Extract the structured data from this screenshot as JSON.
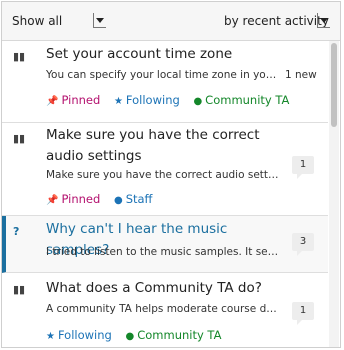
{
  "toolbar": {
    "filter_value": "Show all",
    "sort_value": "by recent activity"
  },
  "threads": [
    {
      "title": "Set your account time zone",
      "preview": "You can specify your local time zone in your account settings",
      "new_count": "1 new",
      "tags": {
        "pinned": "Pinned",
        "following": "Following",
        "community": "Community TA"
      }
    },
    {
      "title": "Make sure you have the correct audio settings",
      "preview": "Make sure you have the correct audio settings on your device",
      "count": "1",
      "tags": {
        "pinned": "Pinned",
        "staff": "Staff"
      }
    },
    {
      "title": "Why can't I hear the music samples?",
      "preview": "I tried to listen to the music samples. It seems like nothing plays",
      "count": "3"
    },
    {
      "title": "What does a Community TA do?",
      "preview": "A community TA helps moderate course discussions",
      "count": "1",
      "tags": {
        "following": "Following",
        "community": "Community TA"
      }
    }
  ],
  "colors": {
    "active_accent": "#1b6f9f",
    "pinned": "#b4126f",
    "following": "#1c73b6",
    "community": "#14872a"
  }
}
